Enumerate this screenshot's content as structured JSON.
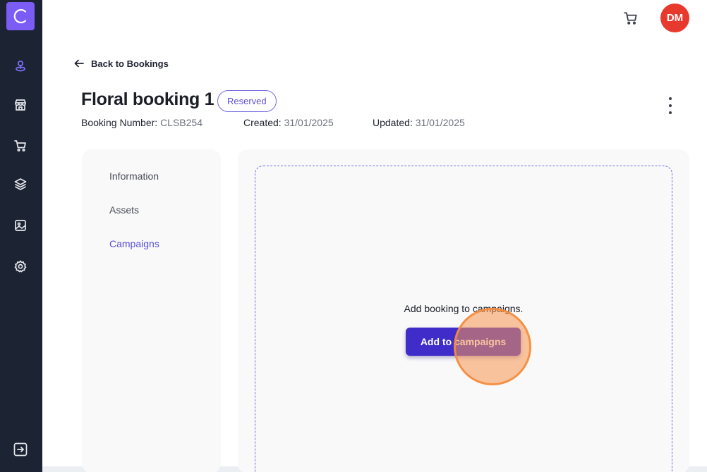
{
  "sidebar": {
    "logo_letter": "C",
    "items": [
      {
        "name": "location-pin-icon",
        "active": true
      },
      {
        "name": "store-icon",
        "active": false
      },
      {
        "name": "cart-icon",
        "active": false
      },
      {
        "name": "layers-icon",
        "active": false
      },
      {
        "name": "image-icon",
        "active": false
      },
      {
        "name": "gear-icon",
        "active": false
      }
    ],
    "logout_icon": "logout-icon"
  },
  "header": {
    "cart_icon": "cart-icon",
    "avatar_initials": "DM"
  },
  "back_link": "Back to Bookings",
  "booking": {
    "title": "Floral booking 1",
    "status": "Reserved",
    "number_label": "Booking Number:",
    "number_value": "CLSB254",
    "created_label": "Created:",
    "created_value": "31/01/2025",
    "updated_label": "Updated:",
    "updated_value": "31/01/2025"
  },
  "tabs": [
    {
      "label": "Information",
      "active": false
    },
    {
      "label": "Assets",
      "active": false
    },
    {
      "label": "Campaigns",
      "active": true
    }
  ],
  "campaigns": {
    "empty_text": "Add booking to campaigns.",
    "add_button": "Add to campaigns"
  },
  "colors": {
    "sidebar_bg": "#1c2333",
    "accent": "#5a4fd1",
    "primary_button": "#3f2cc9",
    "avatar": "#e8392f",
    "logo": "#7b5cf5"
  }
}
